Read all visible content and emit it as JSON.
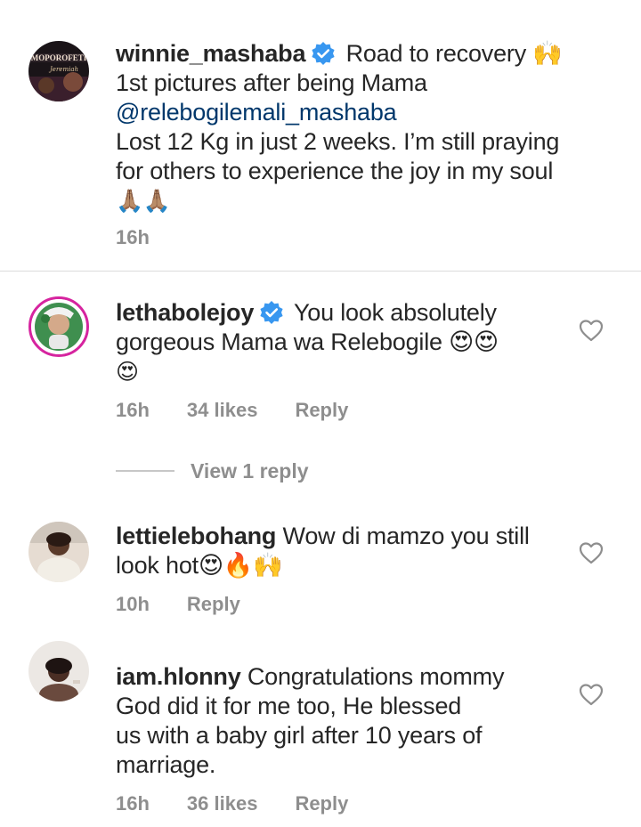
{
  "caption": {
    "username": "winnie_mashaba",
    "line1_rest": "Road to recovery 🙌",
    "line2": "1st pictures after being Mama",
    "mention": "@relebogilemali_mashaba",
    "line4": "Lost 12 Kg in just 2 weeks. I’m still praying",
    "line5": "for others to experience the joy in my soul",
    "emoji": "🙏🏽🙏🏽",
    "time": "16h",
    "avatar_text": "MOPOROFETI"
  },
  "comments": [
    {
      "username": "lethabolejoy",
      "verified": true,
      "text_line1": "You look absolutely",
      "text_line2": "gorgeous Mama wa Relebogile 😍😍",
      "text_line3": "😍",
      "time": "16h",
      "likes": "34 likes",
      "reply": "Reply"
    },
    {
      "username": "lettielebohang",
      "text_line1": "Wow di mamzo you still",
      "text_line2": "look hot😍🔥🙌",
      "time": "10h",
      "reply": "Reply"
    },
    {
      "username": "iam.hlonny",
      "text_line1": "Congratulations mommy",
      "text_line2": "God did it for me too, He blessed",
      "text_line3": "us with a baby girl after 10 years of",
      "text_line4": "marriage.",
      "time": "16h",
      "likes": "36 likes",
      "reply": "Reply"
    }
  ],
  "view_replies_label": "View 1 reply",
  "colors": {
    "text": "#262626",
    "meta": "#8e8e8e",
    "mention": "#00376b",
    "verified": "#3897f0",
    "divider": "#dbdbdb"
  },
  "icons": {
    "verified": "verified-badge-icon",
    "like": "heart-outline-icon"
  }
}
